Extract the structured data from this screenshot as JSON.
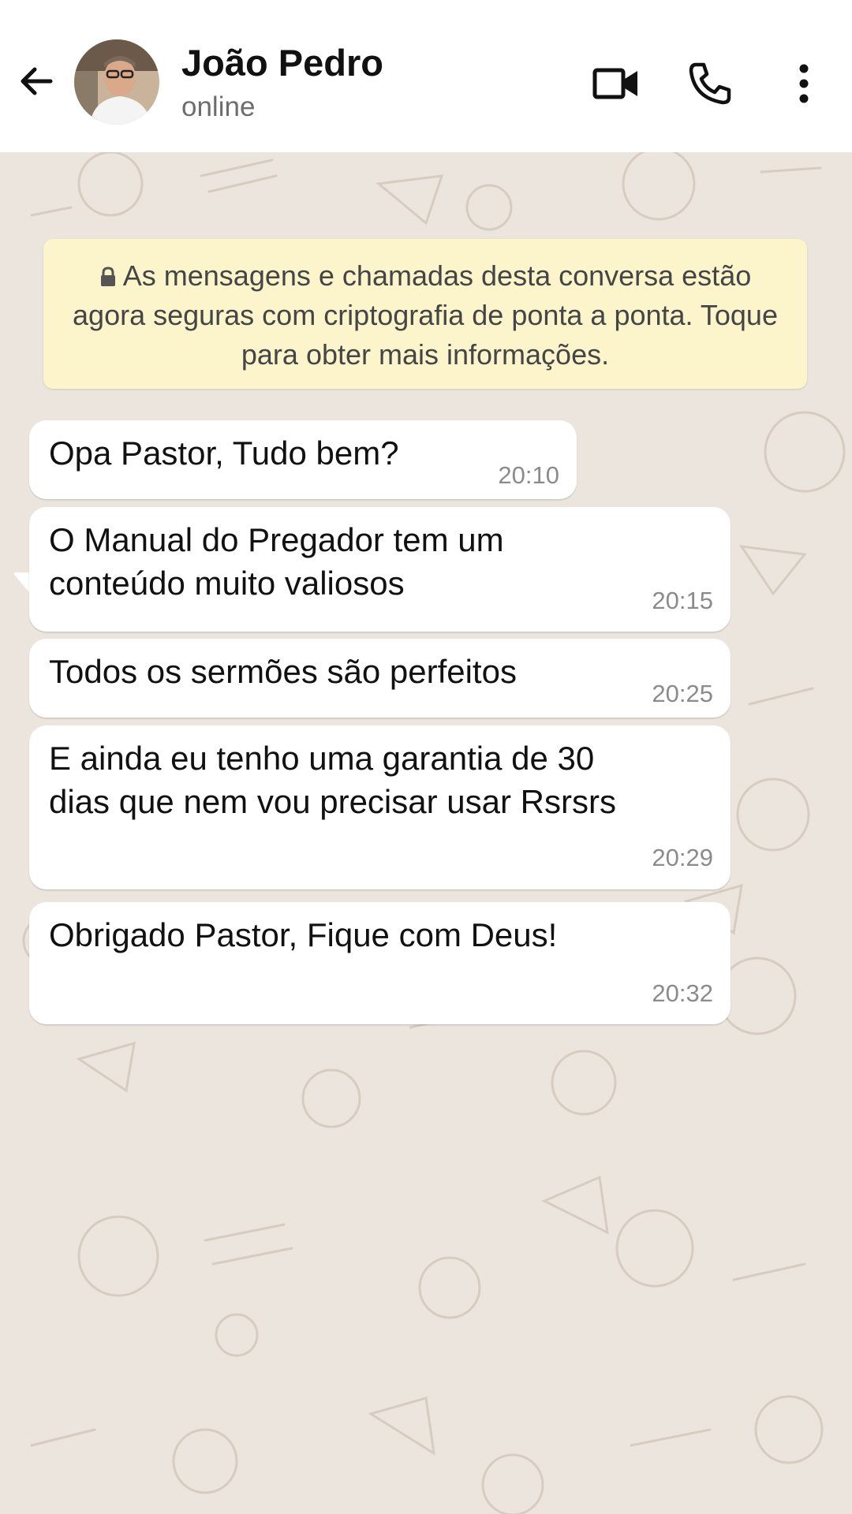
{
  "header": {
    "contact_name": "João Pedro",
    "contact_status": "online",
    "icons": [
      "back-arrow-icon",
      "avatar",
      "video-call-icon",
      "voice-call-icon",
      "more-options-icon"
    ]
  },
  "encryption_notice": {
    "icon": "lock-icon",
    "text": "As mensagens e chamadas desta conversa estão agora seguras com criptografia de ponta a ponta. Toque para obter mais informações."
  },
  "messages": [
    {
      "text": "Opa Pastor, Tudo bem?",
      "time": "20:10"
    },
    {
      "text": "O Manual do Pregador tem um\nconteúdo muito valiosos",
      "time": "20:15"
    },
    {
      "text": "Todos os sermões são perfeitos",
      "time": "20:25"
    },
    {
      "text": "E ainda eu tenho uma garantia de 30\ndias que nem vou precisar usar Rsrsrs",
      "time": "20:29"
    },
    {
      "text": "Obrigado Pastor, Fique com Deus!",
      "time": "20:32"
    }
  ],
  "colors": {
    "chat_background": "#ece5dd",
    "bubble": "#ffffff",
    "notice_background": "#fcf4cb",
    "header": "#ffffff"
  }
}
